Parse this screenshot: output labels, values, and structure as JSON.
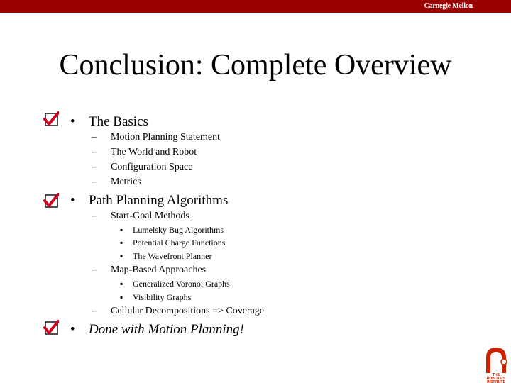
{
  "header": {
    "brand": "Carnegie Mellon",
    "bar_color": "#990000"
  },
  "title": "Conclusion: Complete Overview",
  "sections": [
    {
      "label": "The Basics",
      "checked": true,
      "items": [
        {
          "label": "Motion Planning Statement"
        },
        {
          "label": "The World and Robot"
        },
        {
          "label": "Configuration Space"
        },
        {
          "label": "Metrics"
        }
      ]
    },
    {
      "label": "Path Planning Algorithms",
      "checked": true,
      "items": [
        {
          "label": "Start-Goal Methods",
          "subitems": [
            "Lumelsky Bug Algorithms",
            "Potential Charge Functions",
            "The Wavefront Planner"
          ]
        },
        {
          "label": "Map-Based Approaches",
          "subitems": [
            "Generalized Voronoi Graphs",
            "Visibility Graphs"
          ]
        },
        {
          "label": "Cellular Decompositions => Coverage"
        }
      ]
    },
    {
      "label": "Done with Motion Planning!",
      "checked": true
    }
  ],
  "symbols": {
    "bullet": "•",
    "dash": "–",
    "square": "▪"
  },
  "logo": {
    "line1": "THE",
    "line2": "ROBOTICS",
    "line3": "INSTITUTE",
    "color": "#cc2200"
  },
  "icons": {
    "check": "checkbox-checked-icon",
    "logo": "robotics-institute-logo"
  }
}
